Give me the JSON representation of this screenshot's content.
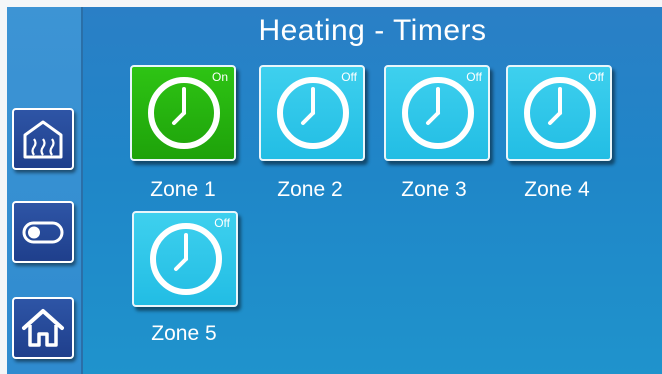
{
  "header": {
    "title": "Heating - Timers"
  },
  "sidebar": {
    "items": [
      {
        "icon": "heating-house-icon"
      },
      {
        "icon": "toggle-switch-icon"
      },
      {
        "icon": "home-icon"
      }
    ]
  },
  "colors": {
    "background": "#1f86c8",
    "tile_off": "#22bde4",
    "tile_on": "#1ea20a",
    "sidebar_button": "#1f3f8c"
  },
  "zones": [
    {
      "label": "Zone 1",
      "state": "On",
      "icon": "clock-icon"
    },
    {
      "label": "Zone 2",
      "state": "Off",
      "icon": "clock-icon"
    },
    {
      "label": "Zone 3",
      "state": "Off",
      "icon": "clock-icon"
    },
    {
      "label": "Zone 4",
      "state": "Off",
      "icon": "clock-icon"
    },
    {
      "label": "Zone 5",
      "state": "Off",
      "icon": "clock-icon"
    }
  ]
}
